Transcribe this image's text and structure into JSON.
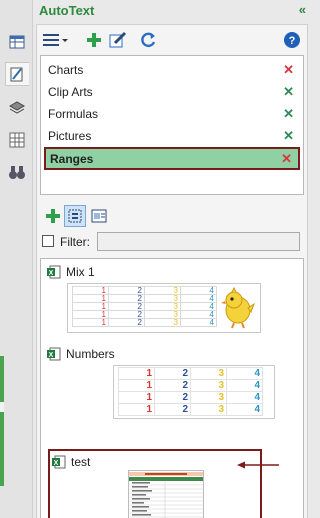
{
  "panel": {
    "title": "AutoText",
    "collapse_glyph": "«"
  },
  "categories": [
    {
      "label": "Charts",
      "delete_color": "#d9363e"
    },
    {
      "label": "Clip Arts",
      "delete_color": "#2e8b57"
    },
    {
      "label": "Formulas",
      "delete_color": "#2e8b57"
    },
    {
      "label": "Pictures",
      "delete_color": "#2e8b57"
    },
    {
      "label": "Ranges",
      "delete_color": "#d9363e",
      "selected": true
    }
  ],
  "filter": {
    "label": "Filter:",
    "value": ""
  },
  "entries": [
    {
      "name": "Mix 1"
    },
    {
      "name": "Numbers"
    },
    {
      "name": "test"
    }
  ],
  "mix1_rows": [
    [
      "1",
      "2",
      "3",
      "4"
    ],
    [
      "1",
      "2",
      "3",
      "4"
    ],
    [
      "1",
      "2",
      "3",
      "4"
    ],
    [
      "1",
      "2",
      "3",
      "4"
    ],
    [
      "1",
      "2",
      "3",
      "4"
    ]
  ],
  "numbers_rows": [
    [
      "1",
      "2",
      "3",
      "4"
    ],
    [
      "1",
      "2",
      "3",
      "4"
    ],
    [
      "1",
      "2",
      "3",
      "4"
    ],
    [
      "1",
      "2",
      "3",
      "4"
    ]
  ],
  "colors": {
    "accent": "#2d8a3e",
    "selected_bg": "#8fd1a3",
    "highlight_border": "#7b1c1c"
  }
}
